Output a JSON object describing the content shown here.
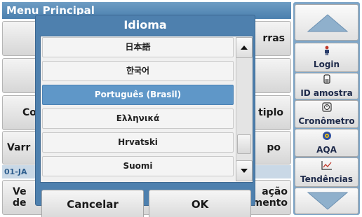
{
  "screen": {
    "menu_title": "Menu Principal",
    "buttons": {
      "top_right": "rras",
      "mid_left": "Co",
      "mid_right": "tiplo",
      "low_left": "Varr",
      "low_right": "po",
      "bottom_left_1": "Ve",
      "bottom_left_2": "de",
      "bottom_right_1": "ação",
      "bottom_right_2": "mento"
    },
    "status_text": "01-JA"
  },
  "sidebar": {
    "items": [
      {
        "label": "Login",
        "icon": "person-icon"
      },
      {
        "label": "ID amostra",
        "icon": "sample-vial-icon"
      },
      {
        "label": "Cronômetro",
        "icon": "timer-icon"
      },
      {
        "label": "AQA",
        "icon": "aqa-icon"
      },
      {
        "label": "Tendências",
        "icon": "trend-chart-icon"
      }
    ]
  },
  "dialog": {
    "title": "Idioma",
    "languages": [
      "日本語",
      "한국어",
      "Português (Brasil)",
      "Ελληνικά",
      "Hrvatski",
      "Suomi"
    ],
    "selected_index": 2,
    "cancel_label": "Cancelar",
    "ok_label": "OK"
  },
  "colors": {
    "dialog_bg": "#4e80ae",
    "selected_row": "#5f97c8",
    "sidebar_bg": "#7fa6c8"
  }
}
